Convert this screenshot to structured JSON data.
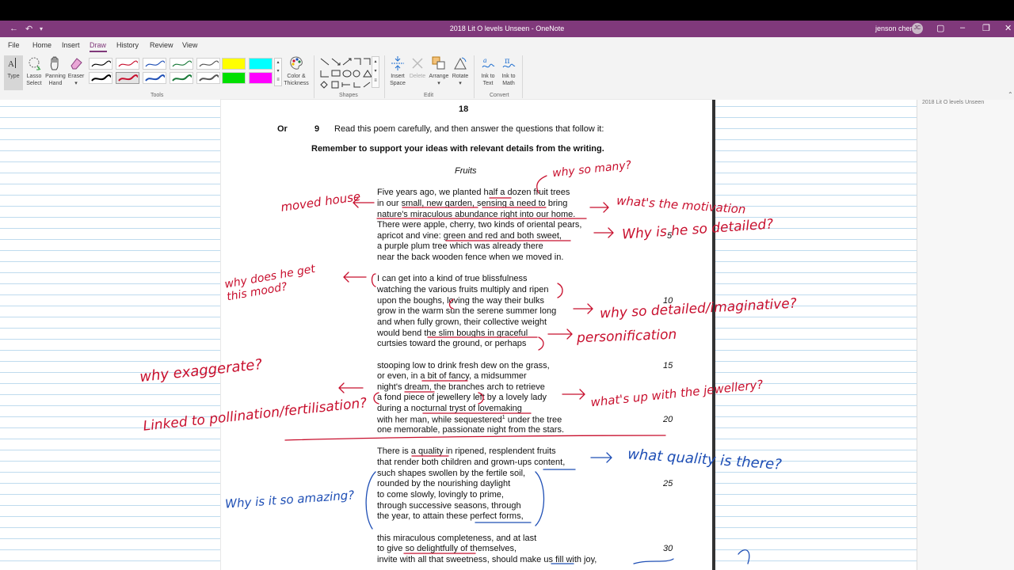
{
  "titlebar": {
    "title": "2018 Lit O levels Unseen  -  OneNote",
    "user": "jenson chen",
    "avatar_initials": "JC"
  },
  "menu": {
    "tabs": [
      "File",
      "Home",
      "Insert",
      "Draw",
      "History",
      "Review",
      "View"
    ],
    "active": "Draw"
  },
  "ribbon": {
    "type": "Type",
    "lasso": [
      "Lasso",
      "Select"
    ],
    "panning": [
      "Panning",
      "Hand"
    ],
    "eraser": "Eraser",
    "color_thickness": [
      "Color &",
      "Thickness"
    ],
    "insert_space": [
      "Insert",
      "Space"
    ],
    "delete": "Delete",
    "arrange": "Arrange",
    "rotate": "Rotate",
    "ink_to_text": [
      "Ink to",
      "Text"
    ],
    "ink_to_math": [
      "Ink to",
      "Math"
    ],
    "groups": [
      "Tools",
      "Shapes",
      "Edit",
      "Convert"
    ],
    "pen_colors": [
      "#000000",
      "#c8102e",
      "#1f4fb5",
      "#1b7a3a",
      "#555555",
      "#000000",
      "#c8102e",
      "#1f4fb5",
      "#1b7a3a",
      "#555555"
    ],
    "highlighters": [
      "#ffff00",
      "#00ffff",
      "#00e000",
      "#ff00ff"
    ]
  },
  "sidepanel": {
    "page_title": "2018 Lit O levels Unseen"
  },
  "document": {
    "page_number": "18",
    "or_label": "Or",
    "question_number": "9",
    "instruction": "Read this poem carefully, and then answer the questions that follow it:",
    "reminder": "Remember to support your ideas with relevant details from the writing.",
    "poem_title": "Fruits",
    "stanzas": [
      [
        "Five years ago, we planted half a dozen fruit trees",
        "in our small, new garden, sensing a need to bring",
        "nature's miraculous abundance right into our home.",
        "There were apple, cherry, two kinds of oriental pears,",
        "apricot and vine: green and red and both sweet,",
        "a purple plum tree which was already there",
        "near the back wooden fence when we moved in."
      ],
      [
        "I can get into a kind of true blissfulness",
        "watching the various fruits multiply and ripen",
        "upon the boughs, loving the way their bulks",
        "grow in the warm sun the serene summer long",
        "and when fully grown, their collective weight",
        "would bend the slim boughs in graceful",
        "curtsies toward the ground, or perhaps"
      ],
      [
        "stooping low to drink fresh dew on the grass,",
        "or even, in a bit of fancy, a midsummer",
        "night's dream, the branches arch to retrieve",
        "a fond piece of jewellery left by a lovely lady",
        "during a nocturnal tryst of lovemaking",
        "with her man, while sequestered",
        "one memorable, passionate night from the stars."
      ],
      [
        "There is a quality in ripened, resplendent fruits",
        "that render both children and grown-ups content,",
        "such shapes swollen by the fertile soil,",
        "rounded by the nourishing daylight",
        "to come slowly, lovingly to prime,",
        "through successive seasons, through",
        "the year, to attain these perfect forms,"
      ],
      [
        "this miraculous completeness, and at last",
        "to give so delightfully of themselves,",
        "invite with all that sweetness, should make us fill with joy,"
      ]
    ],
    "footnote_mark": "1",
    "line_after_sequestered": "under the tree",
    "line_numbers": [
      "5",
      "10",
      "15",
      "20",
      "25",
      "30"
    ]
  },
  "annotations": {
    "red": [
      "why so many?",
      "moved house",
      "what's the motivation",
      "Why is he so detailed?",
      "why does he get this mood?",
      "why so detailed/imaginative?",
      "personification",
      "why exaggerate?",
      "Linked to pollination/fertilisation?",
      "what's up with the jewellery?"
    ],
    "blue": [
      "what quality is there?",
      "Why is it so amazing?"
    ]
  }
}
